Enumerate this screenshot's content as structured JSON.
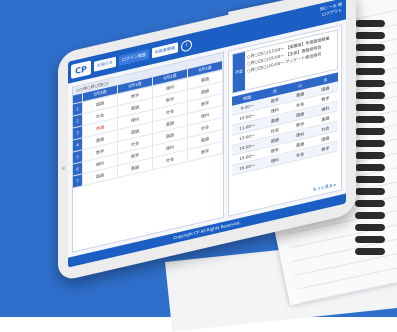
{
  "topbar": {
    "logo": "CP",
    "buttons": [
      "お知らせ",
      "ログイン履歴",
      "利用者情報"
    ],
    "info_icon": "i",
    "user_line1": "田○ 一太 様",
    "user_line2": "ログアウト"
  },
  "left_panel": {
    "header": "○○年○月○日(○)",
    "columns": [
      "",
      "5月3週",
      "6月1週",
      "6月2週",
      "6月3週"
    ],
    "rows": [
      {
        "h": "1",
        "cells": [
          "国語",
          "数学",
          "理科",
          "英語"
        ]
      },
      {
        "h": "2",
        "cells": [
          "社会",
          "英語",
          "数学",
          "国語"
        ]
      },
      {
        "h": "3",
        "cells": [
          "休講",
          "理科",
          "社会",
          "数学"
        ]
      },
      {
        "h": "4",
        "cells": [
          "英語",
          "国語",
          "英語",
          "理科"
        ]
      },
      {
        "h": "5",
        "cells": [
          "数学",
          "社会",
          "国語",
          "社会"
        ]
      },
      {
        "h": "6",
        "cells": [
          "理科",
          "数学",
          "理科",
          "英語"
        ]
      },
      {
        "h": "7",
        "cells": [
          "国語",
          "英語",
          "社会",
          "数学"
        ]
      }
    ]
  },
  "right_panel": {
    "info_label": "予定",
    "info_lines": [
      "○月○日(○)13:00〜  【保護者】年度面談開催",
      "○月○日(○)15:00〜  【生徒】進路説明会",
      "○月○日(○)10:00〜  アンケート提出締切"
    ],
    "schedule_columns": [
      "時間",
      "月",
      "火",
      "水"
    ],
    "schedule_rows": [
      [
        "9:00〜",
        "数学",
        "英語",
        "国語"
      ],
      [
        "10:00〜",
        "理科",
        "社会",
        "数学"
      ],
      [
        "11:00〜",
        "英語",
        "国語",
        "理科"
      ],
      [
        "13:00〜",
        "社会",
        "数学",
        "英語"
      ],
      [
        "14:00〜",
        "国語",
        "理科",
        "社会"
      ],
      [
        "15:00〜",
        "数学",
        "英語",
        "国語"
      ],
      [
        "16:00〜",
        "理科",
        "社会",
        "数学"
      ]
    ],
    "more_link": "もっと見る ▸"
  },
  "footer": "Copyright CP All Rights Reserved."
}
